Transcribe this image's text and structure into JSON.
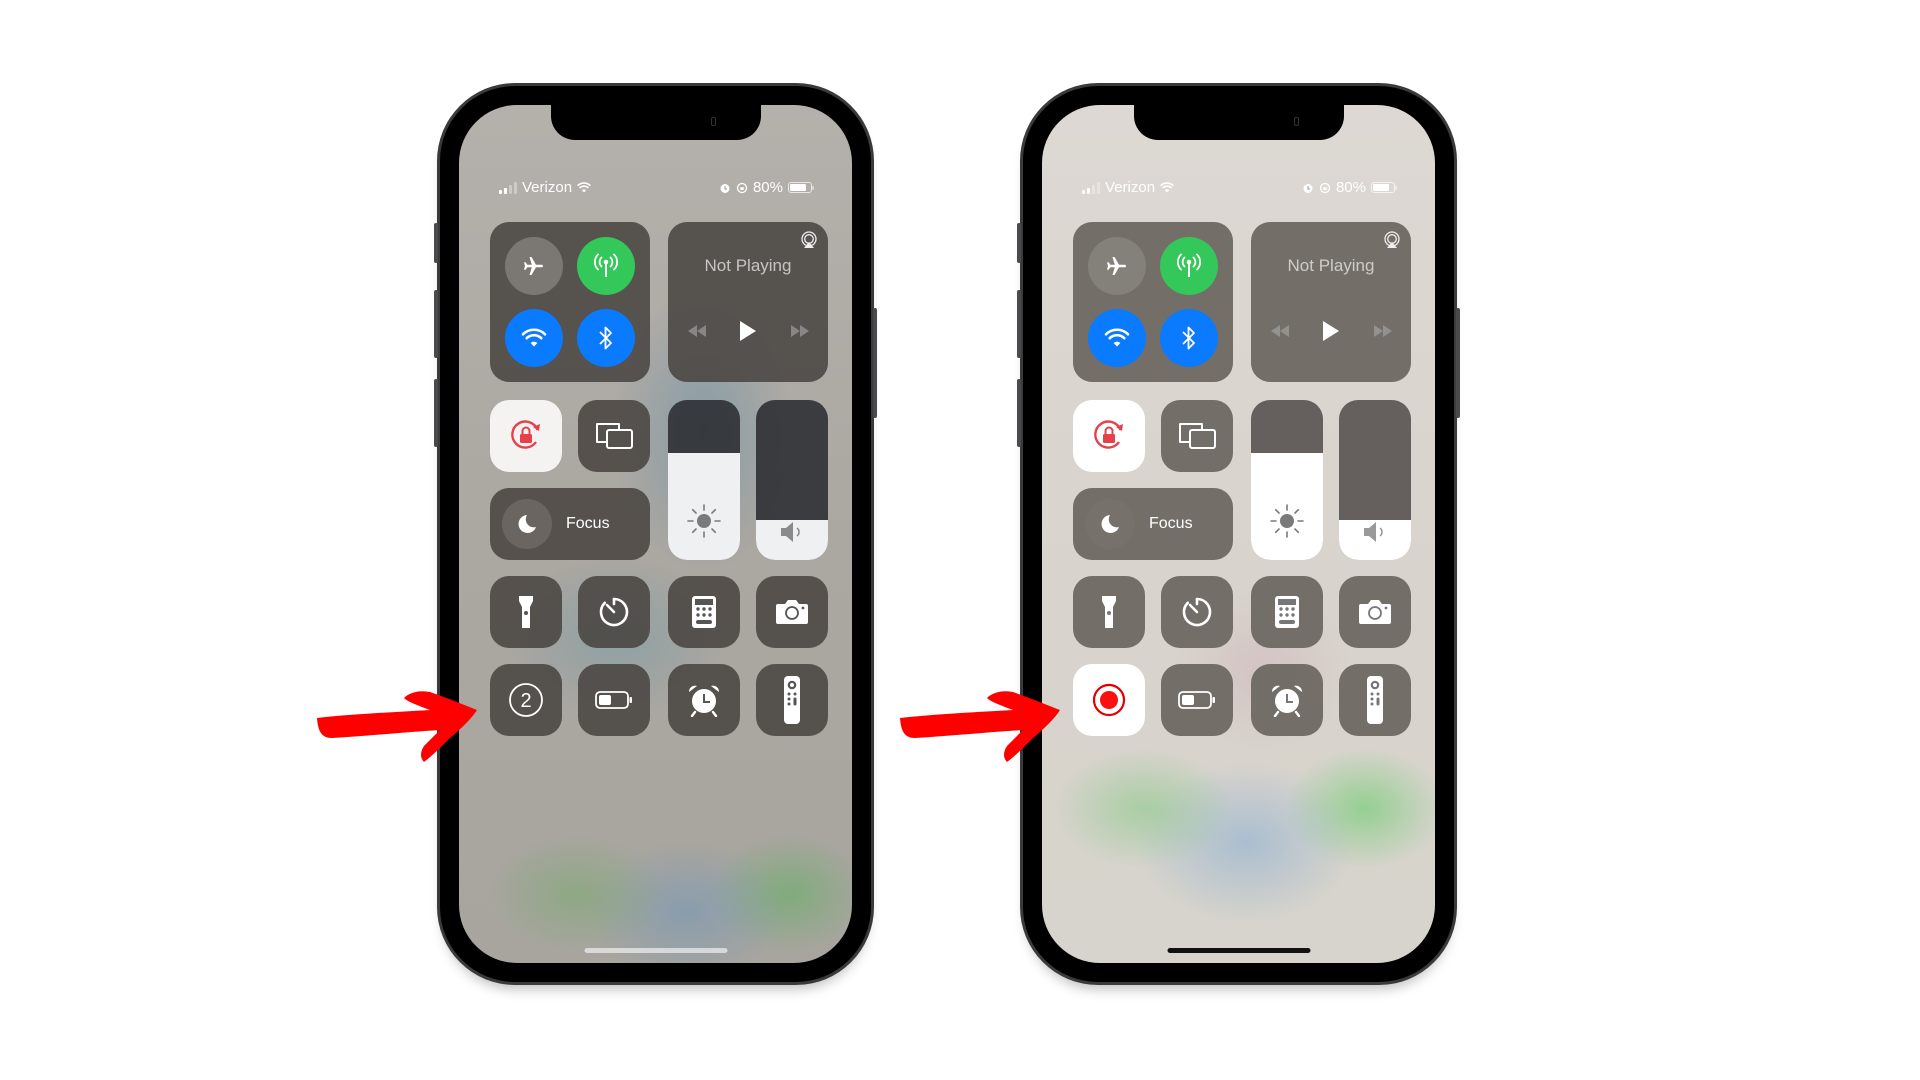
{
  "annotation": {
    "arrow_color": "#ff0000"
  },
  "phones": [
    {
      "id": "before",
      "status": {
        "carrier": "Verizon",
        "battery_pct": "80%",
        "battery_level": 0.8,
        "signal_bars": 2
      },
      "media": {
        "title": "Not Playing"
      },
      "focus_label": "Focus",
      "brightness_level": 0.67,
      "volume_level": 0.25,
      "connectivity": {
        "airplane": "off",
        "cellular": "on",
        "wifi": "on",
        "bluetooth": "on"
      },
      "screen_recording": {
        "state": "countdown",
        "countdown_value": "2"
      },
      "low_power_level": 0.45
    },
    {
      "id": "after",
      "status": {
        "carrier": "Verizon",
        "battery_pct": "80%",
        "battery_level": 0.8,
        "signal_bars": 2
      },
      "media": {
        "title": "Not Playing"
      },
      "focus_label": "Focus",
      "brightness_level": 0.67,
      "volume_level": 0.25,
      "connectivity": {
        "airplane": "off",
        "cellular": "on",
        "wifi": "on",
        "bluetooth": "on"
      },
      "screen_recording": {
        "state": "recording",
        "countdown_value": ""
      },
      "low_power_level": 0.45
    }
  ],
  "colors": {
    "cellular_on": "#34c759",
    "wifi_on": "#0a7aff",
    "bluetooth_on": "#0a7aff",
    "rotation_lock": "#e8404a",
    "record": "#e00000"
  }
}
